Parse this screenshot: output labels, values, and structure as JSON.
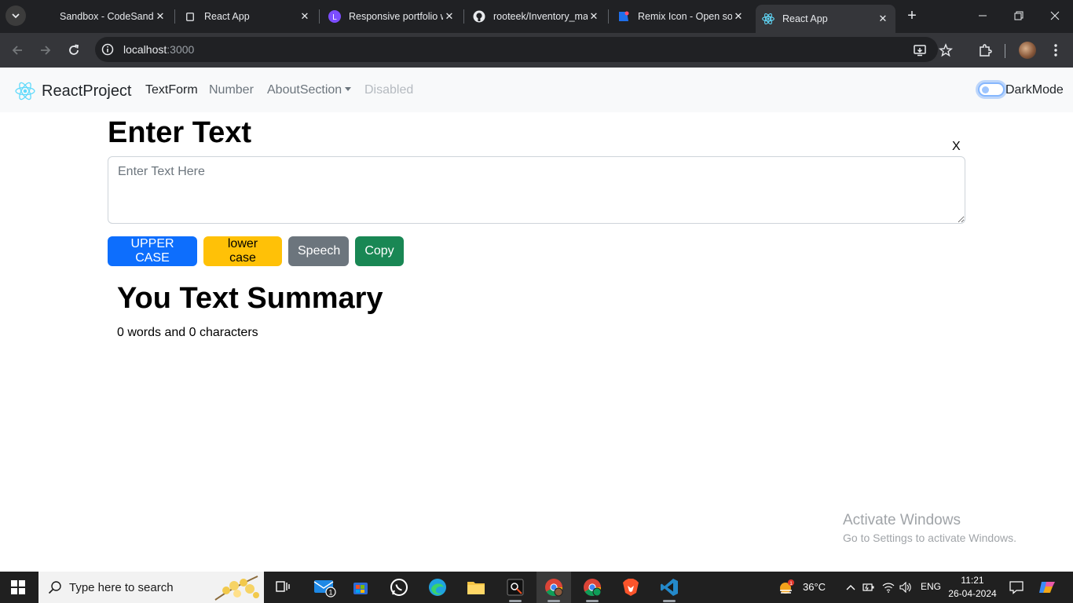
{
  "browser": {
    "tabs": [
      {
        "title": "Sandbox - CodeSandbox",
        "favicon": "codesandbox-icon"
      },
      {
        "title": "React App",
        "favicon": "blank-page-icon"
      },
      {
        "title": "Responsive portfolio website",
        "favicon": "letter-l-icon"
      },
      {
        "title": "rooteek/Inventory_management",
        "favicon": "github-icon"
      },
      {
        "title": "Remix Icon - Open source icons",
        "favicon": "remix-icon"
      },
      {
        "title": "React App",
        "favicon": "react-icon",
        "active": true
      }
    ],
    "url_host": "localhost",
    "url_port": ":3000"
  },
  "navbar": {
    "brand": "ReactProject",
    "links": {
      "textform": "TextForm",
      "number": "Number",
      "about": "AboutSection",
      "disabled": "Disabled"
    },
    "darkmode_label": "DarkMode"
  },
  "main": {
    "heading": "Enter Text",
    "clear_label": "X",
    "textarea_placeholder": "Enter Text Here",
    "textarea_value": "",
    "buttons": {
      "upper": "UPPER CASE",
      "lower": "lower case",
      "speech": "Speech",
      "copy": "Copy"
    },
    "summary_title": "You Text Summary",
    "summary_text": "0 words and 0 characters"
  },
  "watermark": {
    "title": "Activate Windows",
    "subtitle": "Go to Settings to activate Windows."
  },
  "taskbar": {
    "search_placeholder": "Type here to search",
    "mail_badge": "1",
    "weather_badge": "1",
    "temperature": "36°C",
    "language": "ENG",
    "time": "11:21",
    "date": "26-04-2024"
  },
  "colors": {
    "primary": "#0d6efd",
    "warning": "#ffc107",
    "secondary": "#6c757d",
    "success": "#198754",
    "react": "#61dafb"
  }
}
